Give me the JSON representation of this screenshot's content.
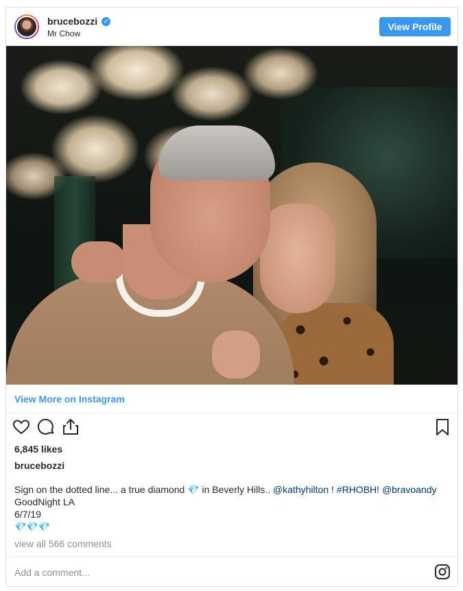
{
  "header": {
    "username": "brucebozzi",
    "verified_glyph": "✓",
    "location": "Mr Chow",
    "view_profile_label": "View Profile"
  },
  "photo": {
    "alt": "brucebozzi photo"
  },
  "links": {
    "view_more": "View More on Instagram"
  },
  "actions": {
    "icons": [
      "heart-icon",
      "comment-icon",
      "share-icon",
      "bookmark-icon"
    ]
  },
  "stats": {
    "likes": "6,845 likes"
  },
  "caption": {
    "username": "brucebozzi",
    "line1_text": "Sign on the dotted line... a true diamond",
    "line1_gem": "💎",
    "line1_mid": " in Beverly Hills.. ",
    "mention1": "@kathyhilton",
    "sep1": " ! ",
    "hashtag": "#RHOBH",
    "sep2": "! ",
    "mention2": "@bravoandy",
    "line2": "GoodNight LA",
    "line3": "6/7/19",
    "line4": "💎💎💎"
  },
  "comments": {
    "view_all": "view all 566 comments",
    "placeholder": "Add a comment..."
  },
  "colors": {
    "accent": "#3897f0",
    "link": "#003569",
    "muted": "#8e8e8e",
    "border": "#dbdbdb"
  }
}
